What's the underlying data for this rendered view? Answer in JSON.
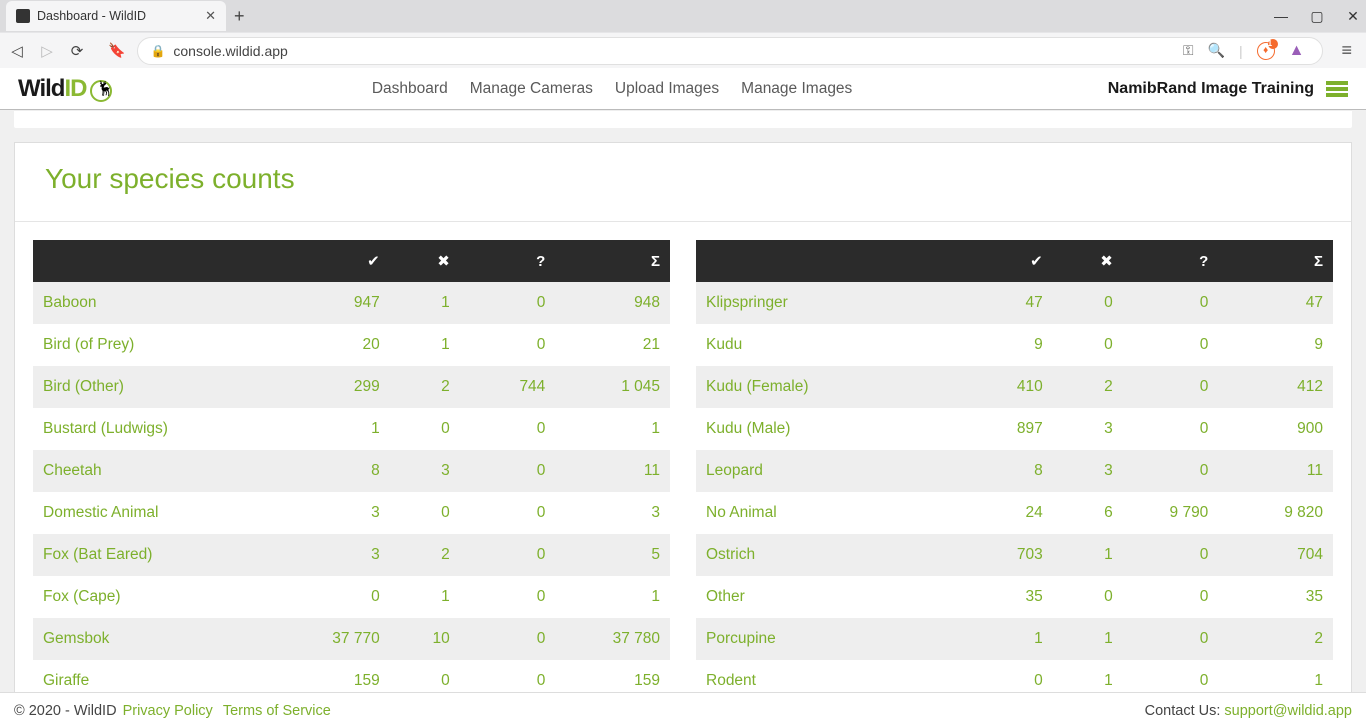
{
  "browser": {
    "tab_title": "Dashboard - WildID",
    "url": "console.wildid.app"
  },
  "header": {
    "logo_text_a": "Wild",
    "logo_text_b": "ID",
    "nav": [
      "Dashboard",
      "Manage Cameras",
      "Upload Images",
      "Manage Images"
    ],
    "project": "NamibRand Image Training"
  },
  "page_title": "Your species counts",
  "table_left": [
    {
      "name": "Baboon",
      "ok": "947",
      "x": "1",
      "q": "0",
      "sum": "948"
    },
    {
      "name": "Bird (of Prey)",
      "ok": "20",
      "x": "1",
      "q": "0",
      "sum": "21"
    },
    {
      "name": "Bird (Other)",
      "ok": "299",
      "x": "2",
      "q": "744",
      "sum": "1 045"
    },
    {
      "name": "Bustard (Ludwigs)",
      "ok": "1",
      "x": "0",
      "q": "0",
      "sum": "1"
    },
    {
      "name": "Cheetah",
      "ok": "8",
      "x": "3",
      "q": "0",
      "sum": "11"
    },
    {
      "name": "Domestic Animal",
      "ok": "3",
      "x": "0",
      "q": "0",
      "sum": "3"
    },
    {
      "name": "Fox (Bat Eared)",
      "ok": "3",
      "x": "2",
      "q": "0",
      "sum": "5"
    },
    {
      "name": "Fox (Cape)",
      "ok": "0",
      "x": "1",
      "q": "0",
      "sum": "1"
    },
    {
      "name": "Gemsbok",
      "ok": "37 770",
      "x": "10",
      "q": "0",
      "sum": "37 780"
    },
    {
      "name": "Giraffe",
      "ok": "159",
      "x": "0",
      "q": "0",
      "sum": "159"
    }
  ],
  "table_right": [
    {
      "name": "Klipspringer",
      "ok": "47",
      "x": "0",
      "q": "0",
      "sum": "47"
    },
    {
      "name": "Kudu",
      "ok": "9",
      "x": "0",
      "q": "0",
      "sum": "9"
    },
    {
      "name": "Kudu (Female)",
      "ok": "410",
      "x": "2",
      "q": "0",
      "sum": "412"
    },
    {
      "name": "Kudu (Male)",
      "ok": "897",
      "x": "3",
      "q": "0",
      "sum": "900"
    },
    {
      "name": "Leopard",
      "ok": "8",
      "x": "3",
      "q": "0",
      "sum": "11"
    },
    {
      "name": "No Animal",
      "ok": "24",
      "x": "6",
      "q": "9 790",
      "sum": "9 820"
    },
    {
      "name": "Ostrich",
      "ok": "703",
      "x": "1",
      "q": "0",
      "sum": "704"
    },
    {
      "name": "Other",
      "ok": "35",
      "x": "0",
      "q": "0",
      "sum": "35"
    },
    {
      "name": "Porcupine",
      "ok": "1",
      "x": "1",
      "q": "0",
      "sum": "2"
    },
    {
      "name": "Rodent",
      "ok": "0",
      "x": "1",
      "q": "0",
      "sum": "1"
    }
  ],
  "footer": {
    "copyright": "© 2020 - WildID",
    "privacy": "Privacy Policy",
    "terms": "Terms of Service",
    "contact_label": "Contact Us: ",
    "contact_email": "support@wildid.app"
  }
}
